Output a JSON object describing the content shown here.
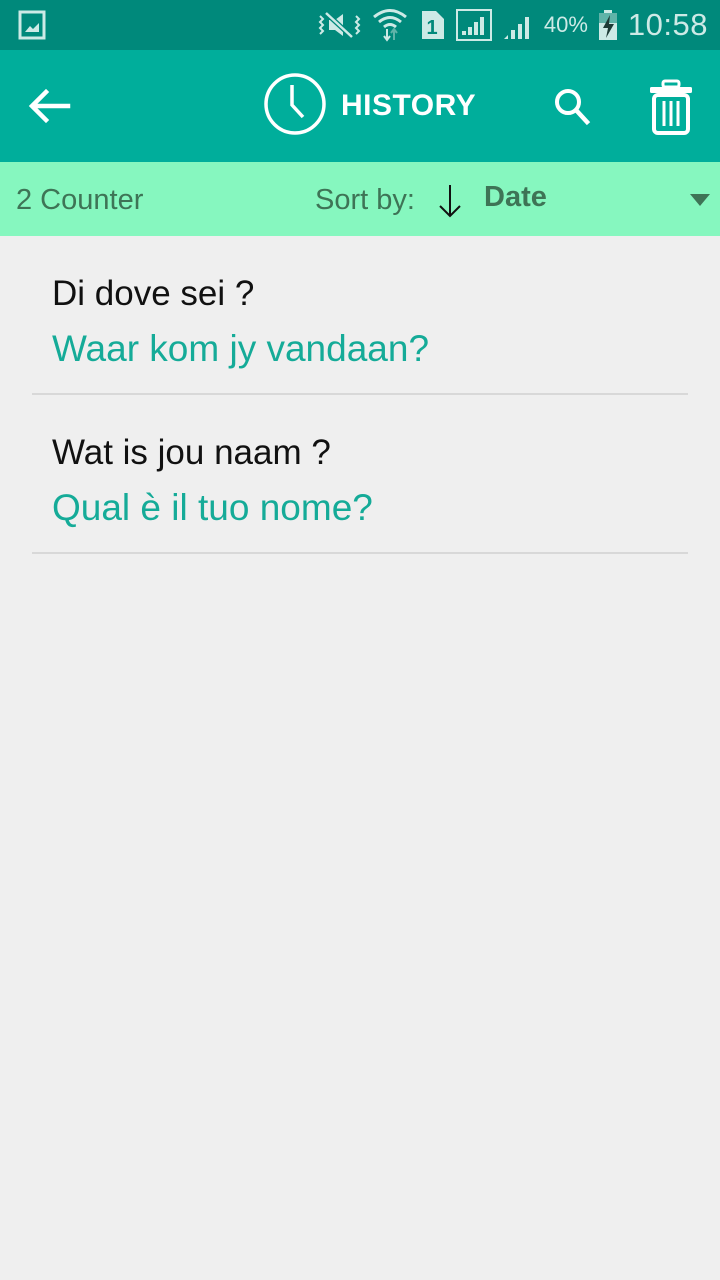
{
  "status_bar": {
    "battery_percent": "40%",
    "time": "10:58",
    "sim_slot": "1",
    "icons": [
      "gallery-notification-icon",
      "vibrate-mute-icon",
      "wifi-icon",
      "sim-1-icon",
      "signal-icon",
      "signal-icon",
      "battery-charging-icon"
    ]
  },
  "app_bar": {
    "title": "HISTORY",
    "icons": [
      "back-arrow-icon",
      "clock-icon",
      "search-icon",
      "trash-icon"
    ]
  },
  "sub_bar": {
    "counter": "2 Counter",
    "sort_label": "Sort by:",
    "sort_direction_icon": "arrow-down-icon",
    "sort_value": "Date"
  },
  "history": [
    {
      "source": "Di dove sei ?",
      "translation": "Waar kom jy vandaan?"
    },
    {
      "source": "Wat is jou naam ?",
      "translation": "Qual è il tuo nome?"
    }
  ],
  "colors": {
    "status_bar": "#00897b",
    "app_bar": "#00ae9b",
    "sub_bar": "#86f7bf",
    "translation_text": "#15ab98",
    "background": "#efefef"
  }
}
